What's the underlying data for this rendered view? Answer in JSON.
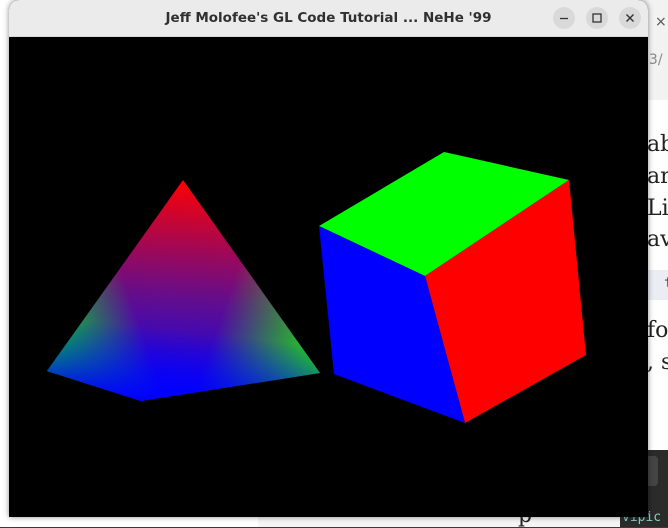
{
  "window": {
    "title": "Jeff Molofee's GL Code Tutorial ... NeHe '99"
  },
  "background": {
    "url_fragment": "23/",
    "text_lines": [
      "ab",
      "ar",
      "Li",
      "av",
      "fo",
      ", s",
      "p"
    ],
    "code_fragment": "t",
    "terminal_lines": [
      "ic",
      "vipic"
    ]
  },
  "scene": {
    "pyramid_vertex_colors": [
      "#ff0000",
      "#00ff00",
      "#0000ff"
    ],
    "cube_face_colors": {
      "top": "#00ff00",
      "front": "#ff0000",
      "left": "#0000ff"
    },
    "clear_color": "#000000"
  }
}
